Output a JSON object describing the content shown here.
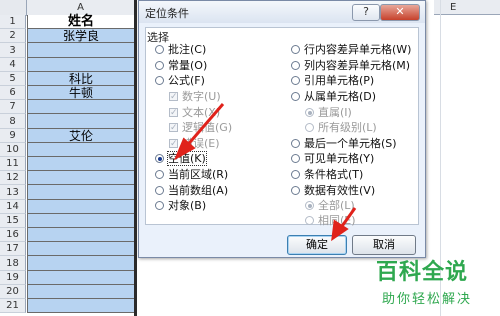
{
  "sheet": {
    "col_a": "A",
    "col_e": "E",
    "rows": [
      {
        "n": "1",
        "v": "姓名",
        "hdr": true
      },
      {
        "n": "2",
        "v": "张学良"
      },
      {
        "n": "3",
        "v": ""
      },
      {
        "n": "4",
        "v": ""
      },
      {
        "n": "5",
        "v": "科比"
      },
      {
        "n": "6",
        "v": "牛顿"
      },
      {
        "n": "7",
        "v": ""
      },
      {
        "n": "8",
        "v": ""
      },
      {
        "n": "9",
        "v": "艾伦"
      },
      {
        "n": "10",
        "v": ""
      },
      {
        "n": "11",
        "v": ""
      },
      {
        "n": "12",
        "v": ""
      },
      {
        "n": "13",
        "v": ""
      },
      {
        "n": "14",
        "v": ""
      },
      {
        "n": "15",
        "v": ""
      },
      {
        "n": "16",
        "v": ""
      },
      {
        "n": "17",
        "v": ""
      },
      {
        "n": "18",
        "v": ""
      },
      {
        "n": "19",
        "v": ""
      },
      {
        "n": "20",
        "v": ""
      },
      {
        "n": "21",
        "v": ""
      }
    ]
  },
  "dialog": {
    "title": "定位条件",
    "help": "?",
    "close": "✕",
    "section_label": "选择",
    "left_options": [
      {
        "label": "批注(C)",
        "type": "radio"
      },
      {
        "label": "常量(O)",
        "type": "radio"
      },
      {
        "label": "公式(F)",
        "type": "radio"
      },
      {
        "label": "数字(U)",
        "type": "check",
        "disabled": true
      },
      {
        "label": "文本(X)",
        "type": "check",
        "disabled": true
      },
      {
        "label": "逻辑值(G)",
        "type": "check",
        "disabled": true
      },
      {
        "label": "错误(E)",
        "type": "check",
        "disabled": true
      },
      {
        "label": "空值(K)",
        "type": "radio",
        "checked": true
      },
      {
        "label": "当前区域(R)",
        "type": "radio"
      },
      {
        "label": "当前数组(A)",
        "type": "radio"
      },
      {
        "label": "对象(B)",
        "type": "radio"
      }
    ],
    "right_options": [
      {
        "label": "行内容差异单元格(W)",
        "type": "radio"
      },
      {
        "label": "列内容差异单元格(M)",
        "type": "radio"
      },
      {
        "label": "引用单元格(P)",
        "type": "radio"
      },
      {
        "label": "从属单元格(D)",
        "type": "radio"
      },
      {
        "label": "直属(I)",
        "type": "radio",
        "disabled": true,
        "checked": true
      },
      {
        "label": "所有级别(L)",
        "type": "radio",
        "disabled": true
      },
      {
        "label": "最后一个单元格(S)",
        "type": "radio"
      },
      {
        "label": "可见单元格(Y)",
        "type": "radio"
      },
      {
        "label": "条件格式(T)",
        "type": "radio"
      },
      {
        "label": "数据有效性(V)",
        "type": "radio"
      },
      {
        "label": "全部(L)",
        "type": "radio",
        "disabled": true,
        "checked": true
      },
      {
        "label": "相同(E)",
        "type": "radio",
        "disabled": true
      }
    ],
    "ok_label": "确定",
    "cancel_label": "取消"
  },
  "watermark": {
    "line1": "百科全说",
    "line2": "助你轻松解决"
  },
  "colors": {
    "selection": "#b7d3f1",
    "arrow": "#e0221b",
    "watermark": "#2fa84f"
  }
}
